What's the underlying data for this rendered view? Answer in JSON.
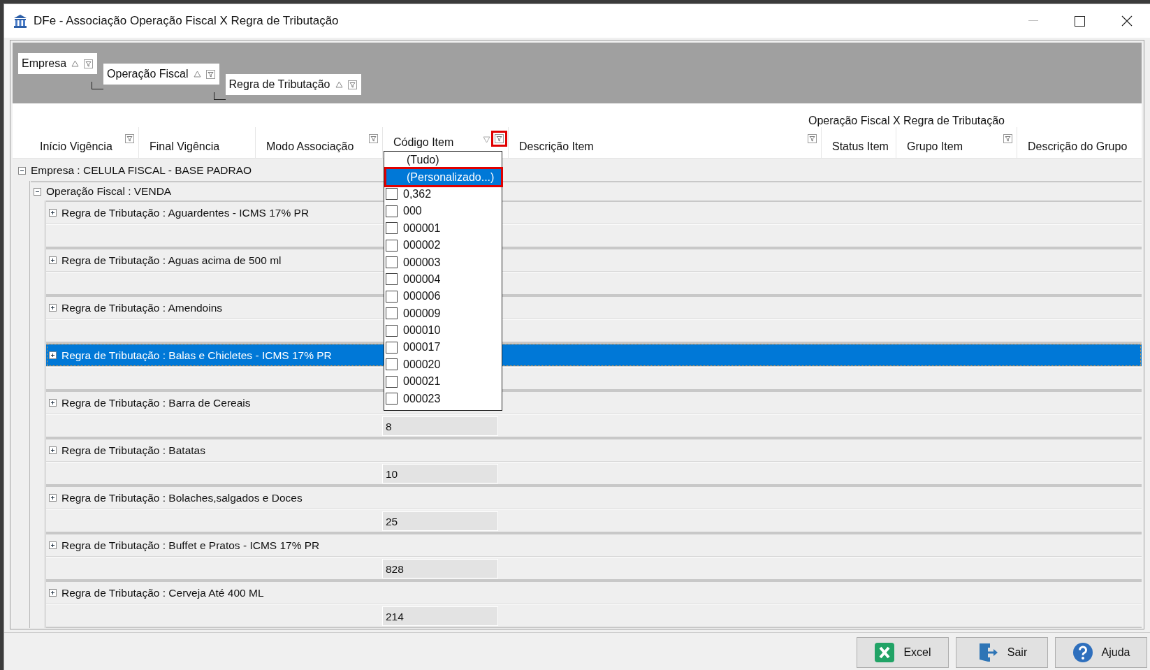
{
  "window": {
    "title": "DFe - Associação Operação Fiscal X Regra de Tributação"
  },
  "group_panel": {
    "fields": [
      {
        "label": "Empresa",
        "sort_ascending": true,
        "filter": true
      },
      {
        "label": "Operação Fiscal",
        "sort_ascending": true,
        "filter": true
      },
      {
        "label": "Regra de Tributação",
        "sort_ascending": true,
        "filter": true
      }
    ]
  },
  "grid": {
    "band_title": "Operação Fiscal X Regra de Tributação",
    "columns": [
      {
        "label": "Início Vigência",
        "filter": true,
        "sorted": false,
        "annotated": false
      },
      {
        "label": "Final Vigência",
        "filter": false,
        "sorted": false,
        "annotated": false
      },
      {
        "label": "Modo Associação",
        "filter": true,
        "sorted": false,
        "annotated": false
      },
      {
        "label": "Código Item",
        "filter": true,
        "sorted": true,
        "annotated": true
      },
      {
        "label": "Descrição Item",
        "filter": true,
        "sorted": false,
        "annotated": false
      },
      {
        "label": "Status Item",
        "filter": false,
        "sorted": false,
        "annotated": false
      },
      {
        "label": "Grupo Item",
        "filter": true,
        "sorted": false,
        "annotated": false
      },
      {
        "label": "Descrição do Grupo",
        "filter": false,
        "sorted": false,
        "annotated": false
      }
    ],
    "tree": [
      {
        "label": "Empresa : CELULA FISCAL - BASE PADRAO",
        "expanded": true,
        "selected": false,
        "children": [
          {
            "label": "Operação Fiscal : VENDA",
            "expanded": true,
            "selected": false,
            "children": [
              {
                "label": "Regra de Tributação : Aguardentes -  ICMS 17% PR",
                "expanded": false,
                "selected": false
              },
              {
                "label": "Regra de Tributação : Aguas acima de 500 ml",
                "expanded": false,
                "selected": false
              },
              {
                "label": "Regra de Tributação : Amendoins",
                "expanded": false,
                "selected": false
              },
              {
                "label": "Regra de Tributação : Balas e Chicletes  - ICMS 17% PR",
                "expanded": false,
                "selected": true
              },
              {
                "label": "Regra de Tributação : Barra de Cereais",
                "expanded": false,
                "selected": false,
                "code": "8"
              },
              {
                "label": "Regra de Tributação : Batatas",
                "expanded": false,
                "selected": false,
                "code": "10"
              },
              {
                "label": "Regra de Tributação : Bolaches,salgados e Doces",
                "expanded": false,
                "selected": false,
                "code": "25"
              },
              {
                "label": "Regra de Tributação : Buffet e Pratos - ICMS 17% PR",
                "expanded": false,
                "selected": false,
                "code": "828"
              },
              {
                "label": "Regra de Tributação : Cerveja Até 400 ML",
                "expanded": false,
                "selected": false,
                "code": "214"
              }
            ]
          }
        ]
      }
    ]
  },
  "filter_popup": {
    "items": [
      {
        "label": "(Tudo)",
        "kind": "option",
        "selected": false,
        "annotated": false
      },
      {
        "label": "(Personalizado...)",
        "kind": "option",
        "selected": true,
        "annotated": true
      },
      {
        "label": "0,362",
        "kind": "check",
        "checked": false,
        "selected": false
      },
      {
        "label": "000",
        "kind": "check",
        "checked": false,
        "selected": false
      },
      {
        "label": "000001",
        "kind": "check",
        "checked": false,
        "selected": false
      },
      {
        "label": "000002",
        "kind": "check",
        "checked": false,
        "selected": false
      },
      {
        "label": "000003",
        "kind": "check",
        "checked": false,
        "selected": false
      },
      {
        "label": "000004",
        "kind": "check",
        "checked": false,
        "selected": false
      },
      {
        "label": "000006",
        "kind": "check",
        "checked": false,
        "selected": false
      },
      {
        "label": "000009",
        "kind": "check",
        "checked": false,
        "selected": false
      },
      {
        "label": "000010",
        "kind": "check",
        "checked": false,
        "selected": false
      },
      {
        "label": "000017",
        "kind": "check",
        "checked": false,
        "selected": false
      },
      {
        "label": "000020",
        "kind": "check",
        "checked": false,
        "selected": false
      },
      {
        "label": "000021",
        "kind": "check",
        "checked": false,
        "selected": false
      },
      {
        "label": "000023",
        "kind": "check",
        "checked": false,
        "selected": false
      }
    ]
  },
  "buttons": [
    {
      "label": "Excel",
      "kind": "excel"
    },
    {
      "label": "Sair",
      "kind": "exit"
    },
    {
      "label": "Ajuda",
      "kind": "help"
    }
  ]
}
